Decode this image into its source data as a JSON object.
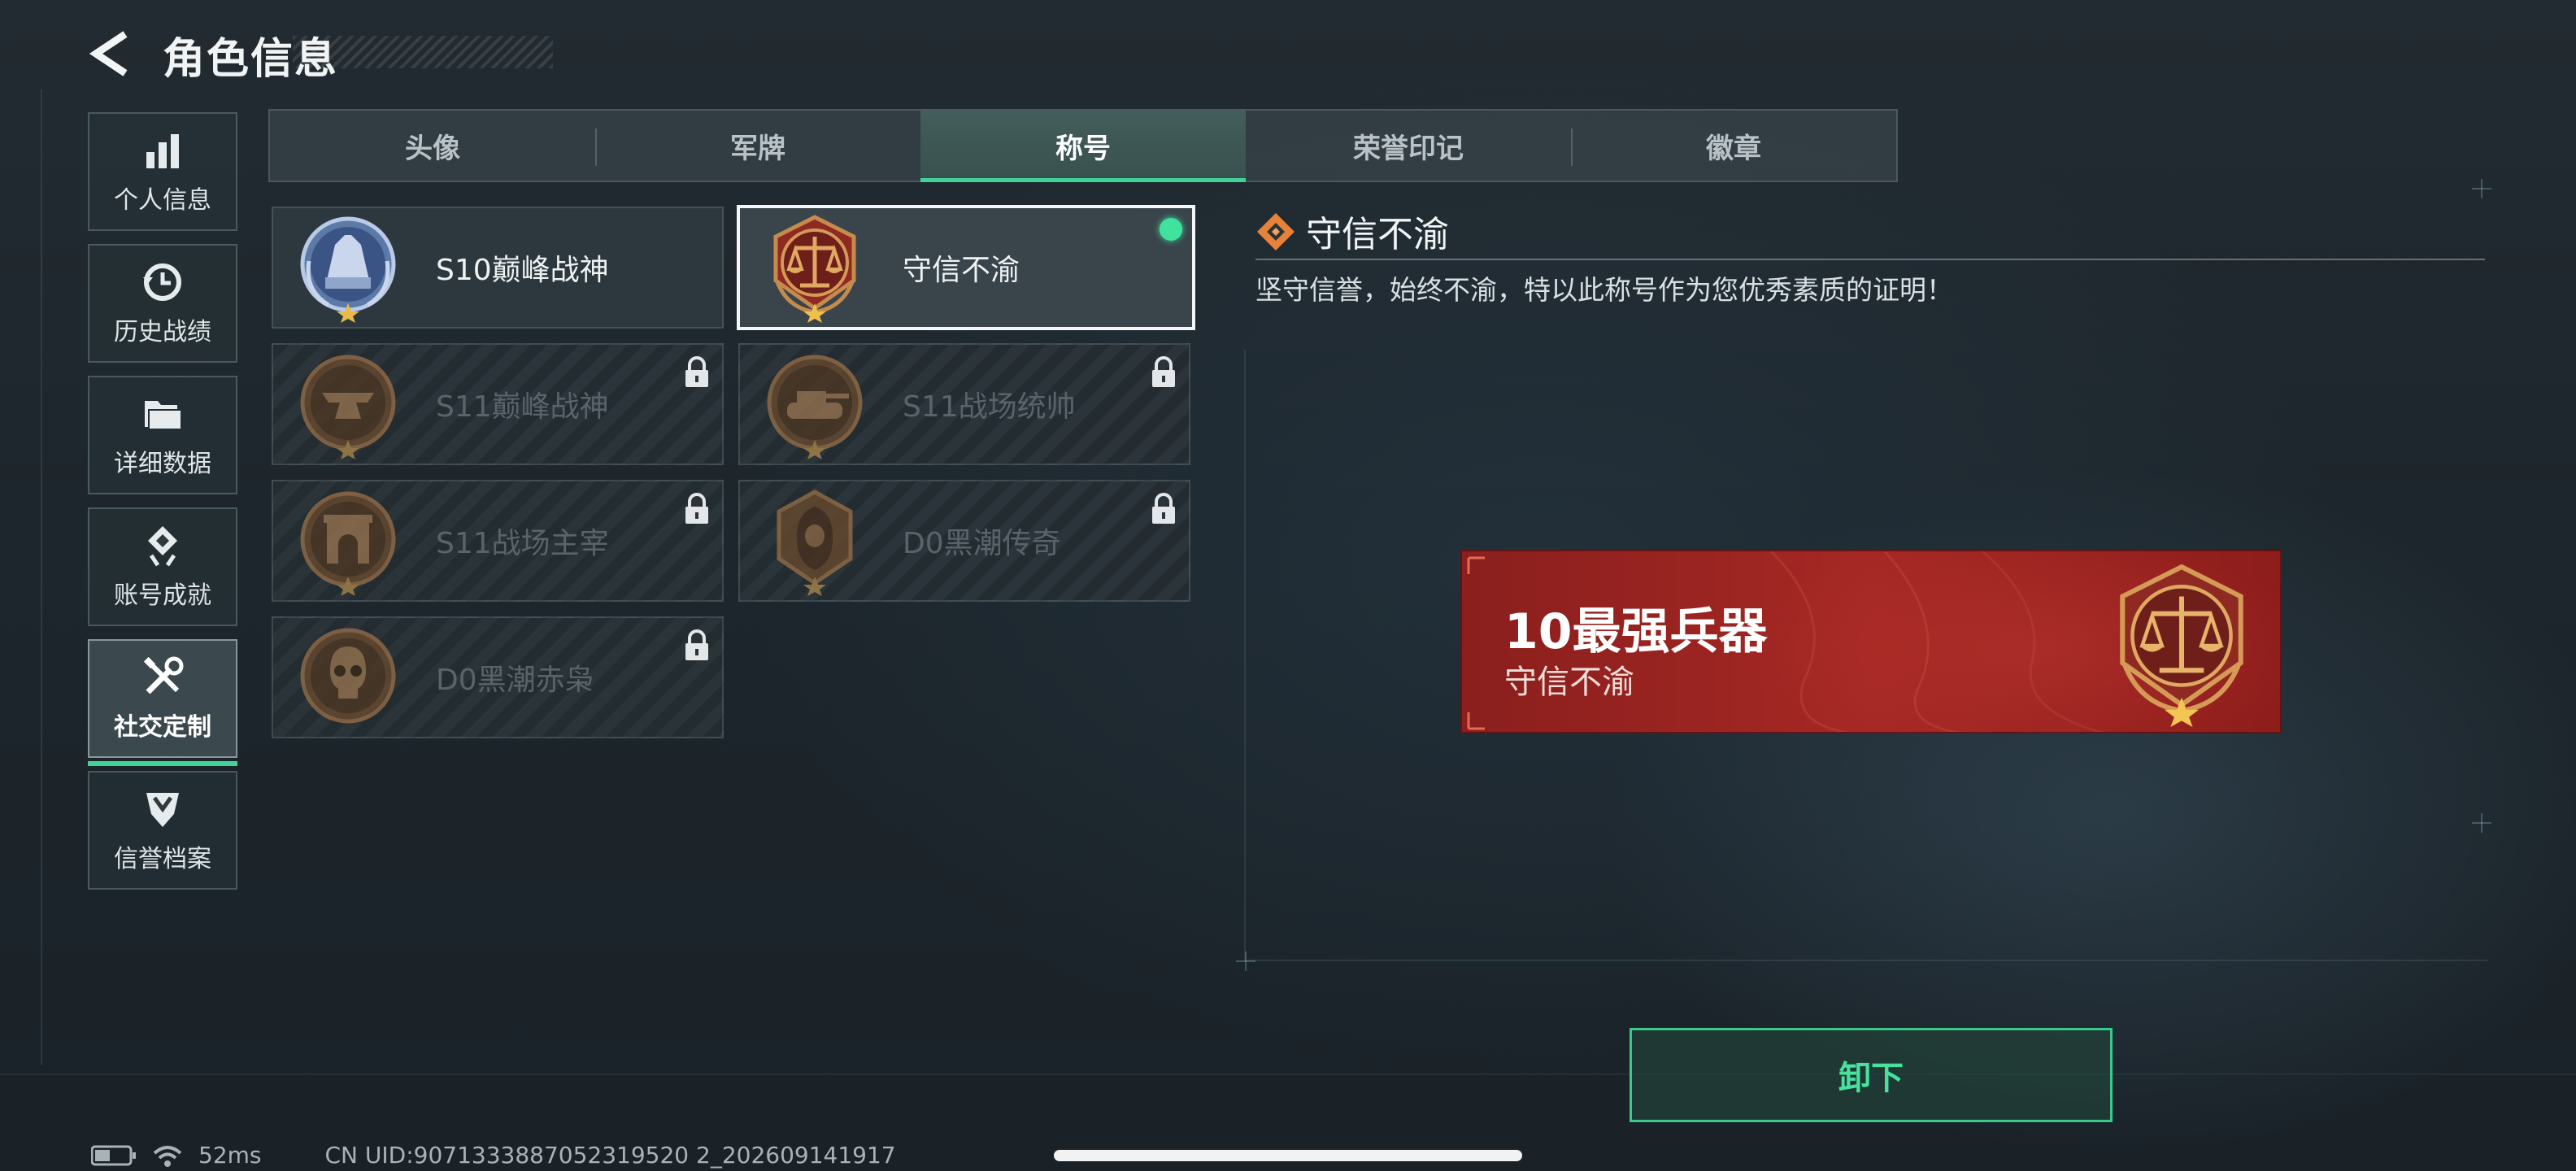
{
  "header": {
    "title": "角色信息"
  },
  "sidebar": {
    "items": [
      {
        "label": "个人信息",
        "icon": "bar-chart-icon"
      },
      {
        "label": "历史战绩",
        "icon": "clock-history-icon"
      },
      {
        "label": "详细数据",
        "icon": "folder-icon"
      },
      {
        "label": "账号成就",
        "icon": "achievement-icon"
      },
      {
        "label": "社交定制",
        "icon": "tools-icon",
        "active": true
      },
      {
        "label": "信誉档案",
        "icon": "shield-chevron-icon"
      }
    ]
  },
  "tabs": [
    {
      "label": "头像"
    },
    {
      "label": "军牌"
    },
    {
      "label": "称号",
      "active": true
    },
    {
      "label": "荣誉印记"
    },
    {
      "label": "徽章"
    }
  ],
  "titles": [
    {
      "name": "S10巅峰战神",
      "locked": false,
      "selected": false,
      "medal": "fortress-medal-icon"
    },
    {
      "name": "守信不渝",
      "locked": false,
      "selected": true,
      "equipped": true,
      "medal": "scales-medal-icon"
    },
    {
      "name": "S11巅峰战神",
      "locked": true,
      "medal": "anvil-medal-icon"
    },
    {
      "name": "S11战场统帅",
      "locked": true,
      "medal": "tank-medal-icon"
    },
    {
      "name": "S11战场主宰",
      "locked": true,
      "medal": "arch-medal-icon"
    },
    {
      "name": "D0黑潮传奇",
      "locked": true,
      "medal": "hooded-figure-medal-icon"
    },
    {
      "name": "D0黑潮赤枭",
      "locked": true,
      "medal": "skull-medal-icon"
    }
  ],
  "detail": {
    "title": "守信不渝",
    "description": "坚守信誉，始终不渝，特以此称号作为您优秀素质的证明！"
  },
  "preview": {
    "headline": "10最强兵器",
    "subtitle": "守信不渝"
  },
  "actions": {
    "unequip_label": "卸下"
  },
  "status": {
    "latency": "52ms",
    "uid": "CN UID:9071333887052319520 2_202609141917"
  },
  "colors": {
    "accent": "#3fd39a",
    "banner_red": "#a62824",
    "medal_bronze": "#b07a45"
  }
}
